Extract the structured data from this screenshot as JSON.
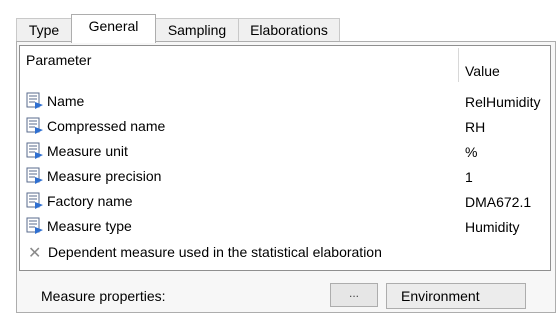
{
  "tabs": [
    {
      "label": "Type",
      "active": false
    },
    {
      "label": "General",
      "active": true
    },
    {
      "label": "Sampling",
      "active": false
    },
    {
      "label": "Elaborations",
      "active": false
    }
  ],
  "table": {
    "headers": {
      "parameter": "Parameter",
      "value": "Value"
    },
    "rows": [
      {
        "label": "Name",
        "value": "RelHumidity",
        "icon": "property-icon"
      },
      {
        "label": "Compressed name",
        "value": "RH",
        "icon": "property-icon"
      },
      {
        "label": "Measure unit",
        "value": "%",
        "icon": "property-icon"
      },
      {
        "label": "Measure precision",
        "value": "1",
        "icon": "property-icon"
      },
      {
        "label": "Factory name",
        "value": "DMA672.1",
        "icon": "property-icon"
      },
      {
        "label": "Measure type",
        "value": "Humidity",
        "icon": "property-icon"
      }
    ],
    "dependent": {
      "label": "Dependent measure used in the statistical elaboration",
      "icon": "close-icon"
    }
  },
  "footer": {
    "label": "Measure properties:",
    "button_label": "...",
    "field_value": "Environment"
  }
}
